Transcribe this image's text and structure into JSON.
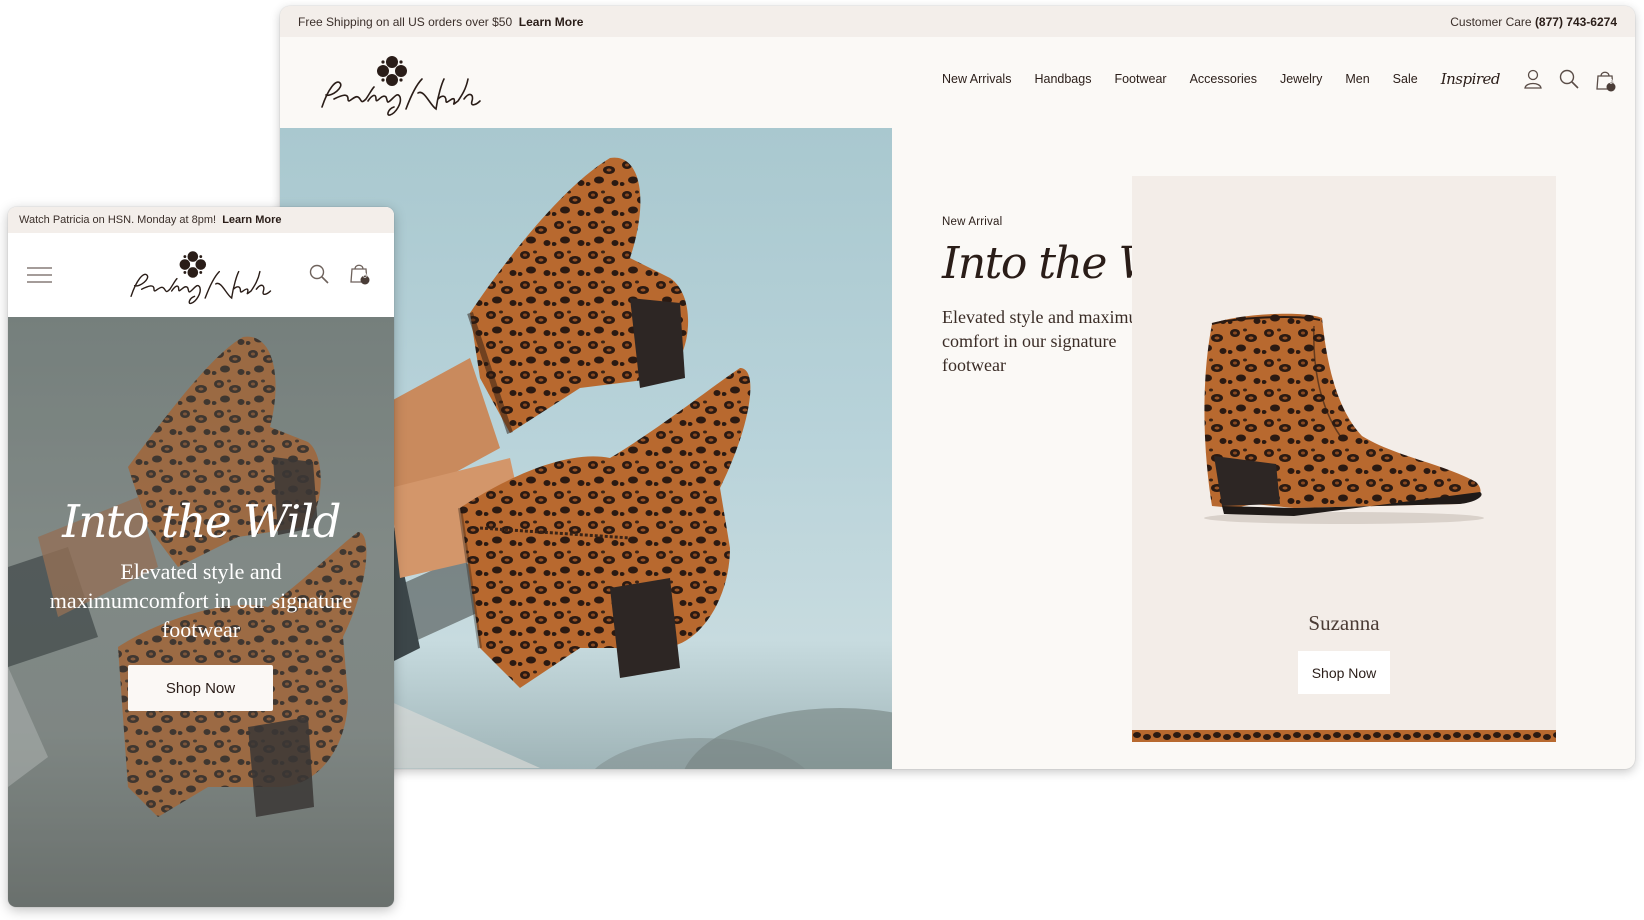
{
  "desktop": {
    "announcement": {
      "text": "Free Shipping on all US orders over $50",
      "link": "Learn More"
    },
    "customer_care": {
      "label": "Customer Care",
      "phone": "(877) 743-6274"
    },
    "brand": "Patricia Nash",
    "nav": [
      {
        "label": "New Arrivals"
      },
      {
        "label": "Handbags"
      },
      {
        "label": "Footwear"
      },
      {
        "label": "Accessories"
      },
      {
        "label": "Jewelry"
      },
      {
        "label": "Men"
      },
      {
        "label": "Sale"
      },
      {
        "label": "Inspired"
      }
    ],
    "nav_icons": [
      "user-icon",
      "search-icon",
      "bag-icon"
    ],
    "cart_count": "0",
    "hero": {
      "eyebrow": "New Arrival",
      "title": "Into the Wild",
      "subtitle": "Elevated style and maximum comfort in our signature footwear"
    },
    "product": {
      "name": "Suzanna",
      "cta": "Shop Now"
    }
  },
  "mobile": {
    "announcement": {
      "text": "Watch Patricia on HSN. Monday at 8pm!",
      "link": "Learn More"
    },
    "brand": "Patricia Nash",
    "cart_count": "0",
    "hero": {
      "title": "Into the Wild",
      "subtitle": "Elevated style and maximumcomfort in our signature footwear",
      "cta": "Shop Now"
    }
  },
  "colors": {
    "brand_dark": "#2a1d18",
    "cream": "#fbf9f6",
    "topbar": "#f3eeea",
    "card": "#f3ede8",
    "leopard_base": "#b46a33",
    "leopard_spot": "#2b1a12"
  }
}
